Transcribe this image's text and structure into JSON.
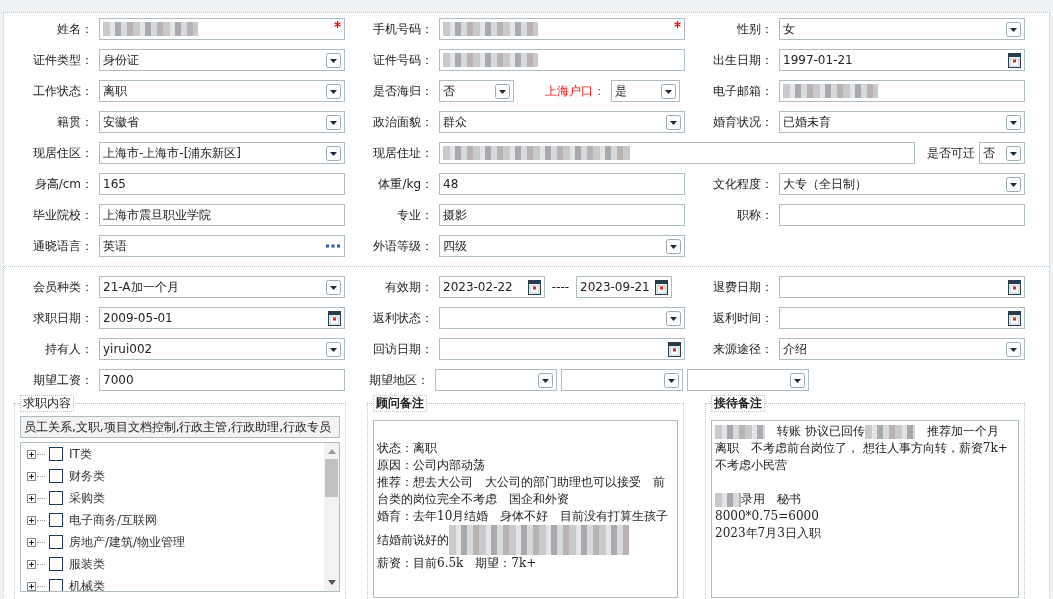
{
  "sections": [
    {
      "rows": [
        [
          {
            "kind": "single",
            "items": [
              {
                "kind": "label",
                "text": "姓名：",
                "alert": false
              },
              {
                "kind": "text",
                "required": true,
                "redacted": true
              }
            ]
          },
          {
            "kind": "single",
            "items": [
              {
                "kind": "label",
                "text": "手机号码：",
                "alert": false
              },
              {
                "kind": "text",
                "required": true,
                "redacted": true
              }
            ]
          },
          {
            "kind": "single",
            "items": [
              {
                "kind": "label",
                "text": "性别：",
                "alert": false
              },
              {
                "kind": "select",
                "value": "女",
                "required": false,
                "redacted": false
              }
            ]
          }
        ],
        [
          {
            "kind": "single",
            "items": [
              {
                "kind": "label",
                "text": "证件类型：",
                "alert": false
              },
              {
                "kind": "select",
                "value": "身份证",
                "required": false,
                "redacted": false
              }
            ]
          },
          {
            "kind": "single",
            "items": [
              {
                "kind": "label",
                "text": "证件号码：",
                "alert": false
              },
              {
                "kind": "text",
                "required": false,
                "redacted": true
              }
            ]
          },
          {
            "kind": "single",
            "items": [
              {
                "kind": "label",
                "text": "出生日期：",
                "alert": false
              },
              {
                "kind": "date",
                "value": "1997-01-21",
                "required": false,
                "redacted": false
              }
            ]
          }
        ],
        [
          {
            "kind": "single",
            "items": [
              {
                "kind": "label",
                "text": "工作状态：",
                "alert": false
              },
              {
                "kind": "select",
                "value": "离职",
                "required": false,
                "redacted": false
              }
            ]
          },
          {
            "kind": "pair",
            "items": [
              {
                "kind": "label",
                "text": "是否海归：",
                "alert": false
              },
              {
                "kind": "select",
                "value": "否",
                "required": false,
                "redacted": false
              },
              {
                "kind": "label",
                "text": "上海户口：",
                "alert": true
              },
              {
                "kind": "select",
                "value": "是",
                "required": false,
                "redacted": false
              }
            ]
          },
          {
            "kind": "single",
            "items": [
              {
                "kind": "label",
                "text": "电子邮箱：",
                "alert": false
              },
              {
                "kind": "text",
                "required": false,
                "redacted": true
              }
            ]
          }
        ],
        [
          {
            "kind": "single",
            "items": [
              {
                "kind": "label",
                "text": "籍贯：",
                "alert": false
              },
              {
                "kind": "select",
                "value": "安徽省",
                "required": false,
                "redacted": false
              }
            ]
          },
          {
            "kind": "single",
            "items": [
              {
                "kind": "label",
                "text": "政治面貌：",
                "alert": false
              },
              {
                "kind": "select",
                "value": "群众",
                "required": false,
                "redacted": false
              }
            ]
          },
          {
            "kind": "single",
            "items": [
              {
                "kind": "label",
                "text": "婚育状况：",
                "alert": false
              },
              {
                "kind": "select",
                "value": "已婚未育",
                "required": false,
                "redacted": false
              }
            ]
          }
        ],
        [
          {
            "kind": "single",
            "items": [
              {
                "kind": "label",
                "text": "现居住区：",
                "alert": false
              },
              {
                "kind": "select",
                "value": "上海市-上海市-[浦东新区]",
                "required": false,
                "redacted": false
              }
            ]
          },
          {
            "kind": "wide",
            "items": [
              {
                "kind": "label",
                "text": "现居住址：",
                "alert": false
              },
              {
                "kind": "text",
                "required": false,
                "redacted": true
              },
              {
                "kind": "label",
                "text": "是否可迁",
                "alert": false
              },
              {
                "kind": "select",
                "value": "否",
                "required": false,
                "redacted": false
              }
            ]
          }
        ],
        [
          {
            "kind": "single",
            "items": [
              {
                "kind": "label",
                "text": "身高/cm：",
                "alert": false
              },
              {
                "kind": "text",
                "value": "165",
                "required": false,
                "redacted": false
              }
            ]
          },
          {
            "kind": "single",
            "items": [
              {
                "kind": "label",
                "text": "体重/kg：",
                "alert": false
              },
              {
                "kind": "text",
                "value": "48",
                "required": false,
                "redacted": false
              }
            ]
          },
          {
            "kind": "single",
            "items": [
              {
                "kind": "label",
                "text": "文化程度：",
                "alert": false
              },
              {
                "kind": "select",
                "value": "大专（全日制）",
                "required": false,
                "redacted": false
              }
            ]
          }
        ],
        [
          {
            "kind": "single",
            "items": [
              {
                "kind": "label",
                "text": "毕业院校：",
                "alert": false
              },
              {
                "kind": "text",
                "value": "上海市震旦职业学院",
                "required": false,
                "redacted": false
              }
            ]
          },
          {
            "kind": "single",
            "items": [
              {
                "kind": "label",
                "text": "专业：",
                "alert": false
              },
              {
                "kind": "text",
                "value": "摄影",
                "required": false,
                "redacted": false
              }
            ]
          },
          {
            "kind": "single",
            "items": [
              {
                "kind": "label",
                "text": "职称：",
                "alert": false
              },
              {
                "kind": "text",
                "required": false,
                "redacted": false
              }
            ]
          }
        ],
        [
          {
            "kind": "single",
            "items": [
              {
                "kind": "label",
                "text": "通晓语言：",
                "alert": false
              },
              {
                "kind": "lookup",
                "value": "英语",
                "required": false,
                "redacted": false
              }
            ]
          },
          {
            "kind": "single",
            "items": [
              {
                "kind": "label",
                "text": "外语等级：",
                "alert": false
              },
              {
                "kind": "select",
                "value": "四级",
                "required": false,
                "redacted": false
              }
            ]
          }
        ]
      ]
    },
    {
      "rows": [
        [
          {
            "kind": "single",
            "items": [
              {
                "kind": "label",
                "text": "会员种类：",
                "alert": false
              },
              {
                "kind": "select",
                "value": "21-A加一个月",
                "required": false,
                "redacted": false
              }
            ]
          },
          {
            "kind": "range",
            "items": [
              {
                "kind": "label",
                "text": "有效期：",
                "alert": false
              },
              {
                "kind": "date",
                "value": "2023-02-22",
                "required": false,
                "redacted": false
              },
              {
                "kind": "separator",
                "text": "----"
              },
              {
                "kind": "date",
                "value": "2023-09-21",
                "required": false,
                "redacted": false
              }
            ]
          },
          {
            "kind": "single",
            "items": [
              {
                "kind": "label",
                "text": "退费日期：",
                "alert": false
              },
              {
                "kind": "date",
                "required": false,
                "redacted": false
              }
            ]
          }
        ],
        [
          {
            "kind": "single",
            "items": [
              {
                "kind": "label",
                "text": "求职日期：",
                "alert": false
              },
              {
                "kind": "date",
                "value": "2009-05-01",
                "required": false,
                "redacted": false
              }
            ]
          },
          {
            "kind": "single",
            "items": [
              {
                "kind": "label",
                "text": "返利状态：",
                "alert": false
              },
              {
                "kind": "select",
                "required": false,
                "redacted": false
              }
            ]
          },
          {
            "kind": "single",
            "items": [
              {
                "kind": "label",
                "text": "返利时间：",
                "alert": false
              },
              {
                "kind": "date",
                "required": false,
                "redacted": false
              }
            ]
          }
        ],
        [
          {
            "kind": "single",
            "items": [
              {
                "kind": "label",
                "text": "持有人：",
                "alert": false
              },
              {
                "kind": "select",
                "value": "yirui002",
                "required": false,
                "redacted": false
              }
            ]
          },
          {
            "kind": "single",
            "items": [
              {
                "kind": "label",
                "text": "回访日期：",
                "alert": false
              },
              {
                "kind": "date",
                "required": false,
                "redacted": false
              }
            ]
          },
          {
            "kind": "single",
            "items": [
              {
                "kind": "label",
                "text": "来源途径：",
                "alert": false
              },
              {
                "kind": "select",
                "value": "介绍",
                "required": false,
                "redacted": false
              }
            ]
          }
        ],
        [
          {
            "kind": "single",
            "items": [
              {
                "kind": "label",
                "text": "期望工资：",
                "alert": false
              },
              {
                "kind": "text",
                "value": "7000",
                "required": false,
                "redacted": false
              }
            ]
          },
          {
            "kind": "triple",
            "items": [
              {
                "kind": "label",
                "text": "期望地区：",
                "alert": false
              },
              {
                "kind": "select",
                "required": false,
                "redacted": false
              },
              {
                "kind": "select",
                "required": false,
                "redacted": false
              },
              {
                "kind": "select",
                "required": false,
                "redacted": false
              }
            ]
          }
        ]
      ]
    }
  ],
  "job_content": {
    "legend": "求职内容",
    "summary": "员工关系,文职,项目文档控制,行政主管,行政助理,行政专员",
    "tree": [
      {
        "label": "IT类",
        "expanded": false,
        "checked": false
      },
      {
        "label": "财务类",
        "expanded": false,
        "checked": false
      },
      {
        "label": "采购类",
        "expanded": false,
        "checked": false
      },
      {
        "label": "电子商务/互联网",
        "expanded": false,
        "checked": false
      },
      {
        "label": "房地产/建筑/物业管理",
        "expanded": false,
        "checked": false
      },
      {
        "label": "服装类",
        "expanded": false,
        "checked": false
      },
      {
        "label": "机械类",
        "expanded": false,
        "checked": false
      }
    ]
  },
  "notes": [
    {
      "legend": "顾问备注",
      "paragraphs": [
        {
          "kind": "blank"
        },
        {
          "kind": "line",
          "segments": [
            {
              "kind": "text",
              "text": "状态：离职"
            }
          ]
        },
        {
          "kind": "line",
          "segments": [
            {
              "kind": "text",
              "text": "原因：公司内部动荡"
            }
          ]
        },
        {
          "kind": "line",
          "segments": [
            {
              "kind": "text",
              "text": "推荐：想去大公司　大公司的部门助理也可以接受　前台类的岗位完全不考虑　国企和外资"
            }
          ]
        },
        {
          "kind": "line",
          "segments": [
            {
              "kind": "text",
              "text": "婚育：去年10月结婚　身体不好　目前没有打算生孩子"
            }
          ]
        },
        {
          "kind": "line",
          "segments": [
            {
              "kind": "text",
              "text": "结婚前说好的"
            },
            {
              "kind": "blur_long"
            }
          ]
        },
        {
          "kind": "line",
          "segments": [
            {
              "kind": "text",
              "text": "薪资：目前6.5k　期望：7k+"
            }
          ]
        }
      ]
    },
    {
      "legend": "接待备注",
      "paragraphs": [
        {
          "kind": "line",
          "segments": [
            {
              "kind": "blur"
            },
            {
              "kind": "text",
              "text": "　转账 协议已回传"
            },
            {
              "kind": "blur"
            },
            {
              "kind": "text",
              "text": "　推荐加一个月"
            }
          ]
        },
        {
          "kind": "line",
          "segments": [
            {
              "kind": "text",
              "text": "离职　不考虑前台岗位了， 想往人事方向转，薪资7k+"
            }
          ]
        },
        {
          "kind": "line",
          "segments": [
            {
              "kind": "text",
              "text": "不考虑小民营"
            }
          ]
        },
        {
          "kind": "blank"
        },
        {
          "kind": "line",
          "segments": [
            {
              "kind": "blur_short"
            },
            {
              "kind": "text",
              "text": "录用　秘书"
            }
          ]
        },
        {
          "kind": "line",
          "segments": [
            {
              "kind": "text",
              "text": "8000*0.75=6000"
            }
          ]
        },
        {
          "kind": "line",
          "segments": [
            {
              "kind": "text",
              "text": "2023年7月3日入职"
            }
          ]
        }
      ]
    }
  ]
}
